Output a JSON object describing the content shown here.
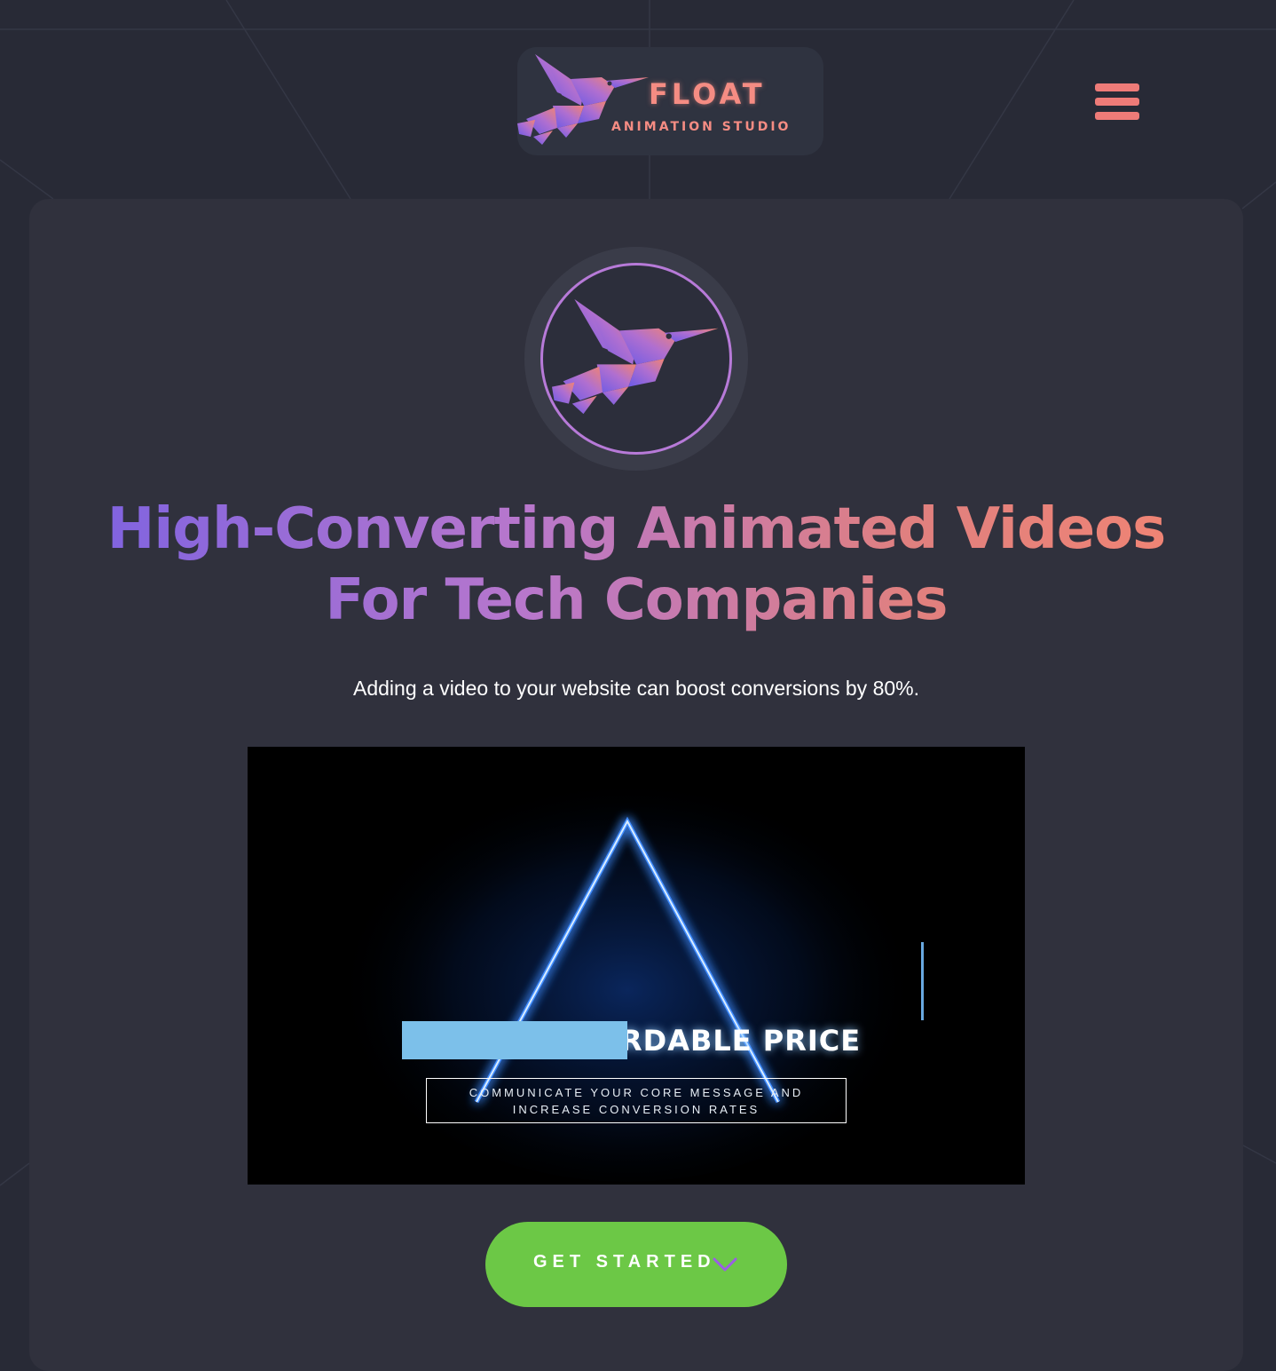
{
  "header": {
    "logo_title": "FLOAT",
    "logo_subtitle": "ANIMATION STUDIO",
    "menu_icon": "hamburger-menu-icon"
  },
  "hero": {
    "avatar_icon": "hummingbird-logo-icon",
    "headline_line1": "High-Converting Animated Videos",
    "headline_line2": "For Tech Companies",
    "subtext": "Adding a video to your website can boost conversions by 80%."
  },
  "video": {
    "title_visible": "RDABLE PRICE",
    "caption_line1": "COMMUNICATE YOUR CORE MESSAGE AND",
    "caption_line2": "INCREASE CONVERSION RATES"
  },
  "cta": {
    "label": "GET STARTED",
    "icon": "chevron-down-icon"
  },
  "colors": {
    "background": "#282a36",
    "card": "#30313d",
    "accent_coral": "#f58c83",
    "accent_purple": "#7f63e0",
    "cta_green": "#6cc846"
  }
}
